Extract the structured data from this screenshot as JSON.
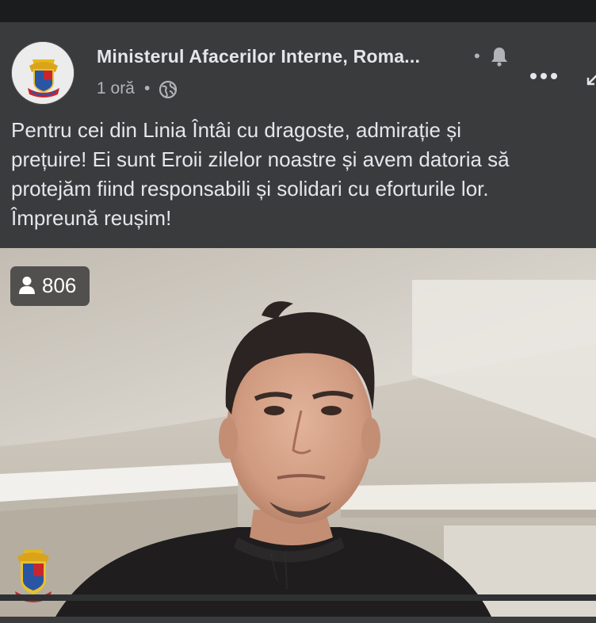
{
  "post": {
    "page_name": "Ministerul Afacerilor Interne, Roma...",
    "name_separator": "•",
    "time": "1 oră",
    "meta_separator": "•",
    "text": "Pentru cei din Linia Întâi cu dragoste, admirație și\nprețuire! Ei sunt Eroii zilelor noastre și avem datoria să\nprotejăm fiind responsabili și solidari cu eforturile lor.\nÎmpreună reușim!"
  },
  "video": {
    "viewer_count": "806"
  },
  "icons": {
    "bell": "bell-icon",
    "globe": "globe-icon",
    "more": "more-options-icon",
    "share": "share-icon",
    "viewers": "person-icon",
    "avatar": "coat-of-arms",
    "watermark": "coat-of-arms"
  },
  "colors": {
    "background": "#3a3b3c",
    "text_primary": "#e4e6eb",
    "text_secondary": "#b0b3b8",
    "badge": "#3c3c3c"
  }
}
